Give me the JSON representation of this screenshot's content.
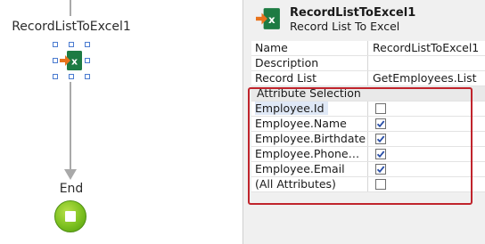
{
  "canvas": {
    "node_title": "RecordListToExcel1",
    "end_label": "End"
  },
  "panel": {
    "title": "RecordListToExcel1",
    "subtitle": "Record List To Excel",
    "properties": [
      {
        "name": "Name",
        "value": "RecordListToExcel1"
      },
      {
        "name": "Description",
        "value": ""
      },
      {
        "name": "Record List",
        "value": "GetEmployees.List"
      }
    ],
    "section_label": "Attribute Selection",
    "attributes": [
      {
        "name": "Employee.Id",
        "checked": false
      },
      {
        "name": "Employee.Name",
        "checked": true
      },
      {
        "name": "Employee.Birthdate",
        "checked": true
      },
      {
        "name": "Employee.PhoneNum...",
        "checked": true
      },
      {
        "name": "Employee.Email",
        "checked": true
      },
      {
        "name": "(All Attributes)",
        "checked": false
      }
    ]
  },
  "colors": {
    "excel_green": "#1d7b43",
    "arrow_orange": "#e8731c",
    "highlight_red": "#c0242c",
    "end_green": "#7cc01f",
    "check_blue": "#2a4fa8"
  },
  "icons": {
    "node": "record-list-to-excel-icon",
    "end": "end-stop-icon",
    "checkbox": "checkbox-icon"
  }
}
